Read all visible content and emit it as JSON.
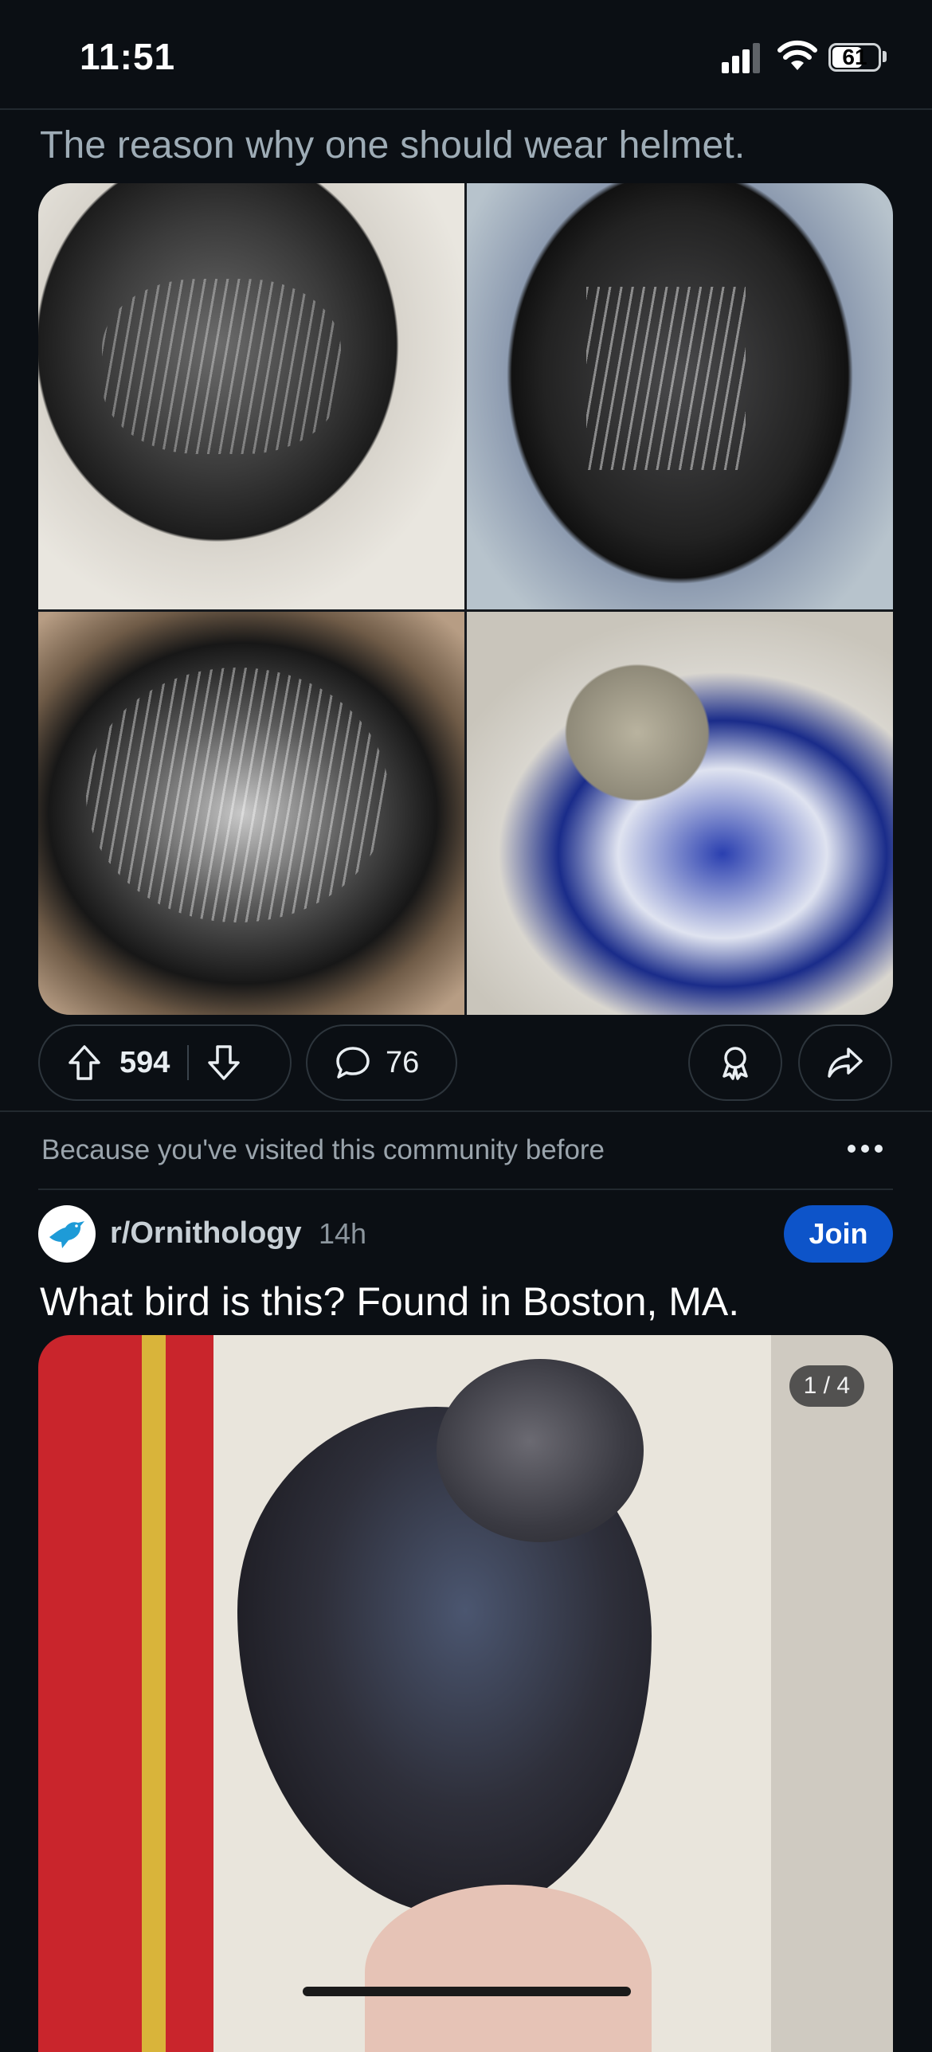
{
  "status_bar": {
    "time": "11:51",
    "battery": "61",
    "battery_level": 0.61
  },
  "post1": {
    "title": "The reason why one should wear helmet.",
    "upvotes": "594",
    "comments": "76"
  },
  "recommendation": {
    "label": "Because you've visited this community before"
  },
  "post2": {
    "subreddit": "r/Ornithology",
    "age": "14h",
    "join_label": "Join",
    "title": "What bird is this? Found in Boston, MA.",
    "image_counter": "1 / 4"
  },
  "colors": {
    "background": "#0b0f14",
    "join_button": "#0d54c9",
    "title_muted": "#9eacb6"
  },
  "icons": [
    "upvote-icon",
    "downvote-icon",
    "comment-icon",
    "award-icon",
    "share-icon",
    "more-icon",
    "bird-logo-icon",
    "wifi-icon",
    "signal-icon",
    "battery-icon"
  ]
}
